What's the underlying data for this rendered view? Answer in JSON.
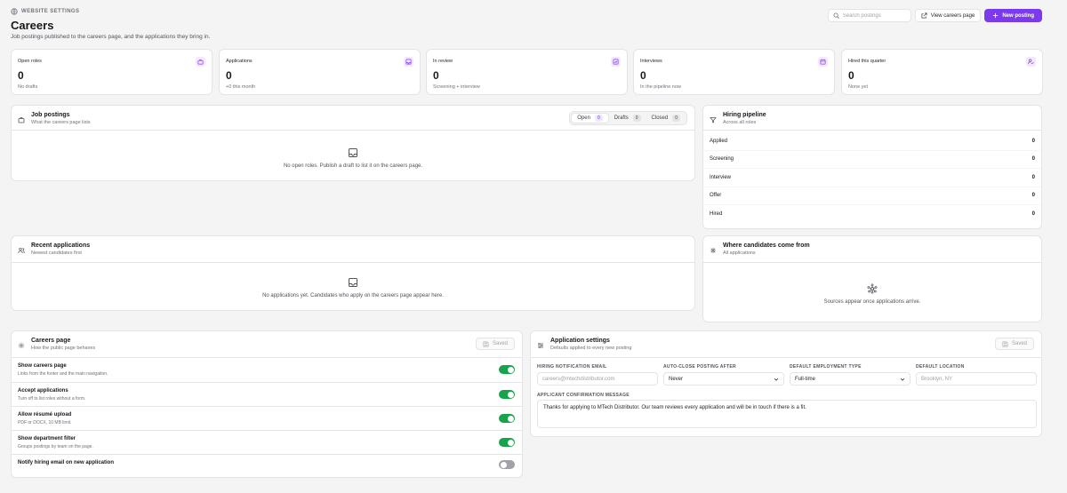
{
  "header": {
    "eyebrow": "WEBSITE SETTINGS",
    "title": "Careers",
    "subtitle": "Job postings published to the careers page, and the applications they bring in.",
    "search_placeholder": "Search postings",
    "view_button": "View careers page",
    "new_button": "New posting"
  },
  "stats": [
    {
      "label": "Open roles",
      "value": "0",
      "sub": "No drafts"
    },
    {
      "label": "Applications",
      "value": "0",
      "sub": "+0 this month"
    },
    {
      "label": "In review",
      "value": "0",
      "sub": "Screening + interview"
    },
    {
      "label": "Interviews",
      "value": "0",
      "sub": "In the pipeline now"
    },
    {
      "label": "Hired this quarter",
      "value": "0",
      "sub": "None yet"
    }
  ],
  "job_postings": {
    "title": "Job postings",
    "sub": "What the careers page lists",
    "tabs": [
      {
        "label": "Open",
        "count": "0"
      },
      {
        "label": "Drafts",
        "count": "0"
      },
      {
        "label": "Closed",
        "count": "0"
      }
    ],
    "empty": "No open roles. Publish a draft to list it on the careers page."
  },
  "pipeline": {
    "title": "Hiring pipeline",
    "sub": "Across all roles",
    "rows": [
      {
        "label": "Applied",
        "count": "0"
      },
      {
        "label": "Screening",
        "count": "0"
      },
      {
        "label": "Interview",
        "count": "0"
      },
      {
        "label": "Offer",
        "count": "0"
      },
      {
        "label": "Hired",
        "count": "0"
      }
    ]
  },
  "recent": {
    "title": "Recent applications",
    "sub": "Newest candidates first",
    "empty": "No applications yet. Candidates who apply on the careers page appear here."
  },
  "sources": {
    "title": "Where candidates come from",
    "sub": "All applications",
    "empty": "Sources appear once applications arrive."
  },
  "careers_page": {
    "title": "Careers page",
    "sub": "How the public page behaves",
    "saved": "Saved",
    "toggles": [
      {
        "title": "Show careers page",
        "desc": "Links from the footer and the main navigation.",
        "on": true
      },
      {
        "title": "Accept applications",
        "desc": "Turn off to list roles without a form.",
        "on": true
      },
      {
        "title": "Allow résumé upload",
        "desc": "PDF or DOCX, 10 MB limit.",
        "on": true
      },
      {
        "title": "Show department filter",
        "desc": "Groups postings by team on the page.",
        "on": true
      },
      {
        "title": "Notify hiring email on new application",
        "desc": "",
        "on": false
      }
    ]
  },
  "app_settings": {
    "title": "Application settings",
    "sub": "Defaults applied to every new posting",
    "saved": "Saved",
    "email_label": "HIRING NOTIFICATION EMAIL",
    "email_placeholder": "careers@mtechdistributor.com",
    "autoclose_label": "AUTO-CLOSE POSTING AFTER",
    "autoclose_value": "Never",
    "emptype_label": "DEFAULT EMPLOYMENT TYPE",
    "emptype_value": "Full-time",
    "location_label": "DEFAULT LOCATION",
    "location_placeholder": "Brooklyn, NY",
    "confirm_label": "APPLICANT CONFIRMATION MESSAGE",
    "confirm_value": "Thanks for applying to MTech Distributor. Our team reviews every application and will be in touch if there is a fit."
  },
  "colors": {
    "accent": "#7c3aed",
    "toggle_on": "#16a34a",
    "toggle_off": "#a1a1aa"
  }
}
